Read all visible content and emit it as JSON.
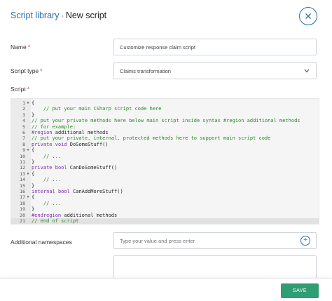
{
  "header": {
    "breadcrumb_library": "Script library",
    "breadcrumb_separator": "›",
    "breadcrumb_current": "New script",
    "close_icon": "close-icon"
  },
  "form": {
    "name_label": "Name",
    "name_value": "Customize response claim script",
    "type_label": "Script type",
    "type_value": "Claims transformation",
    "script_label": "Script",
    "required_marker": "*"
  },
  "editor": {
    "active_line": 21,
    "lines": [
      {
        "num": "1",
        "fold": "▼",
        "tokens": [
          {
            "t": "{",
            "c": "p"
          }
        ]
      },
      {
        "num": "2",
        "fold": "",
        "tokens": [
          {
            "t": "    // put your main CSharp script code here",
            "c": "c"
          }
        ]
      },
      {
        "num": "3",
        "fold": "",
        "tokens": [
          {
            "t": "}",
            "c": "p"
          }
        ]
      },
      {
        "num": "4",
        "fold": "",
        "tokens": [
          {
            "t": "// put your private methods here below main script inside syntax #region additional methods",
            "c": "c"
          }
        ]
      },
      {
        "num": "5",
        "fold": "",
        "tokens": [
          {
            "t": "// for example:",
            "c": "c"
          }
        ]
      },
      {
        "num": "6",
        "fold": "",
        "tokens": [
          {
            "t": "#region",
            "c": "k"
          },
          {
            "t": " additional methods",
            "c": "p"
          }
        ]
      },
      {
        "num": "7",
        "fold": "",
        "tokens": [
          {
            "t": "// put your private, internal, protected methods here to support main script code",
            "c": "c"
          }
        ]
      },
      {
        "num": "8",
        "fold": "",
        "tokens": [
          {
            "t": "private",
            "c": "k"
          },
          {
            "t": " ",
            "c": "p"
          },
          {
            "t": "void",
            "c": "k"
          },
          {
            "t": " DoSomeStuff()",
            "c": "p"
          }
        ]
      },
      {
        "num": "9",
        "fold": "▼",
        "tokens": [
          {
            "t": "{",
            "c": "p"
          }
        ]
      },
      {
        "num": "10",
        "fold": "",
        "tokens": [
          {
            "t": "    // ...",
            "c": "c"
          }
        ]
      },
      {
        "num": "11",
        "fold": "",
        "tokens": [
          {
            "t": "}",
            "c": "p"
          }
        ]
      },
      {
        "num": "12",
        "fold": "",
        "tokens": [
          {
            "t": "private",
            "c": "k"
          },
          {
            "t": " ",
            "c": "p"
          },
          {
            "t": "bool",
            "c": "k"
          },
          {
            "t": " CanDoSomeStuff()",
            "c": "p"
          }
        ]
      },
      {
        "num": "13",
        "fold": "▼",
        "tokens": [
          {
            "t": "{",
            "c": "p"
          }
        ]
      },
      {
        "num": "14",
        "fold": "",
        "tokens": [
          {
            "t": "    // ...",
            "c": "c"
          }
        ]
      },
      {
        "num": "15",
        "fold": "",
        "tokens": [
          {
            "t": "}",
            "c": "p"
          }
        ]
      },
      {
        "num": "16",
        "fold": "",
        "tokens": [
          {
            "t": "internal",
            "c": "k"
          },
          {
            "t": " ",
            "c": "p"
          },
          {
            "t": "bool",
            "c": "k"
          },
          {
            "t": " CanAddMoreStuff()",
            "c": "p"
          }
        ]
      },
      {
        "num": "17",
        "fold": "▼",
        "tokens": [
          {
            "t": "{",
            "c": "p"
          }
        ]
      },
      {
        "num": "18",
        "fold": "",
        "tokens": [
          {
            "t": "    // ...",
            "c": "c"
          }
        ]
      },
      {
        "num": "19",
        "fold": "",
        "tokens": [
          {
            "t": "}",
            "c": "p"
          }
        ]
      },
      {
        "num": "20",
        "fold": "",
        "tokens": [
          {
            "t": "#endregion",
            "c": "k"
          },
          {
            "t": " additional methods",
            "c": "p"
          }
        ]
      },
      {
        "num": "21",
        "fold": "",
        "tokens": [
          {
            "t": "// end of script",
            "c": "c"
          }
        ]
      }
    ]
  },
  "namespaces": {
    "label": "Additional namespaces",
    "placeholder": "Type your value and press enter",
    "add_icon": "plus-circle-icon"
  },
  "footer": {
    "save_label": "SAVE"
  },
  "colors": {
    "accent": "#2b6cb0",
    "save": "#2f9e72",
    "required": "#e53e3e",
    "comment": "#228b22",
    "keyword": "#7a2aa8"
  }
}
